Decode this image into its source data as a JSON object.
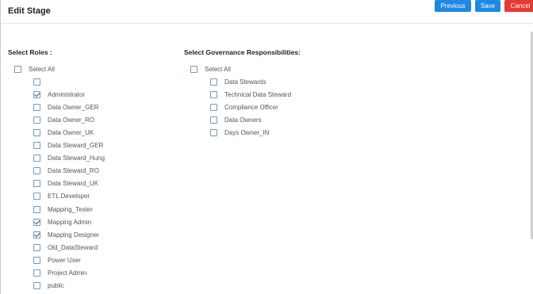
{
  "dialog": {
    "title": "Edit Stage"
  },
  "toolbar": {
    "previous_label": "Previous",
    "save_label": "Save",
    "cancel_label": "Cancel"
  },
  "roles": {
    "heading": "Select Roles :",
    "select_all": {
      "label": "Select All",
      "checked": false
    },
    "items": [
      {
        "label": "",
        "checked": false
      },
      {
        "label": "Administrator",
        "checked": true
      },
      {
        "label": "Data Owner_GER",
        "checked": false
      },
      {
        "label": "Data Owner_RO",
        "checked": false
      },
      {
        "label": "Data Owner_UK",
        "checked": false
      },
      {
        "label": "Data Steward_GER",
        "checked": false
      },
      {
        "label": "Data Steward_Hung",
        "checked": false
      },
      {
        "label": "Data Steward_RO",
        "checked": false
      },
      {
        "label": "Data Steward_UK",
        "checked": false
      },
      {
        "label": "ETL Developer",
        "checked": false
      },
      {
        "label": "Mapping_Tester",
        "checked": false
      },
      {
        "label": "Mapping Admin",
        "checked": true
      },
      {
        "label": "Mapping Designer",
        "checked": true
      },
      {
        "label": "Old_DataSteward",
        "checked": false
      },
      {
        "label": "Power User",
        "checked": false
      },
      {
        "label": "Project Admin",
        "checked": false
      },
      {
        "label": "public",
        "checked": false
      }
    ]
  },
  "governance": {
    "heading": "Select Governance Responsibilities:",
    "select_all": {
      "label": "Select All",
      "checked": false
    },
    "items": [
      {
        "label": "Data Stewards",
        "checked": false
      },
      {
        "label": "Technical Data Steward",
        "checked": false
      },
      {
        "label": "Compliance Officer",
        "checked": false
      },
      {
        "label": "Data Owners",
        "checked": false
      },
      {
        "label": "Days Owner_IN",
        "checked": false
      }
    ]
  },
  "colors": {
    "primary_button": "#1e88e5",
    "cancel_button": "#e53935"
  }
}
